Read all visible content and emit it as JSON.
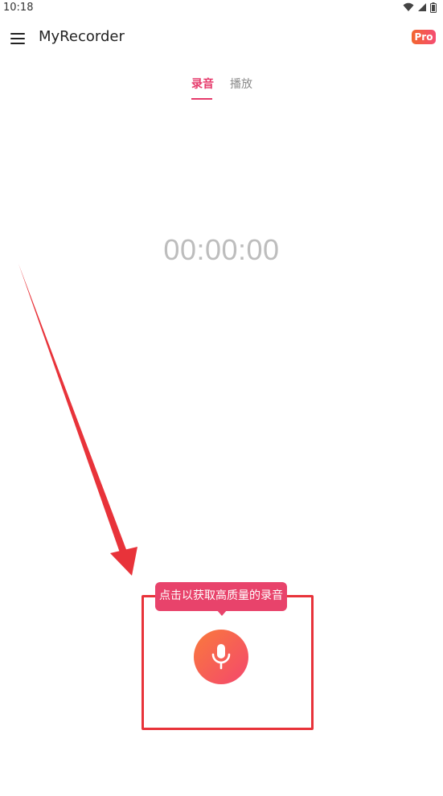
{
  "status_bar": {
    "time": "10:18",
    "icons": [
      "wifi-icon",
      "signal-icon",
      "battery-icon"
    ]
  },
  "app_bar": {
    "title": "MyRecorder",
    "pro_badge": "Pro",
    "menu_icon": "menu-icon"
  },
  "tabs": [
    {
      "label": "录音",
      "active": true
    },
    {
      "label": "播放",
      "active": false
    }
  ],
  "timer": "00:00:00",
  "tooltip": "点击以获取高质量的录音",
  "record_button": {
    "icon": "microphone-icon"
  },
  "colors": {
    "accent": "#e63a6b",
    "tooltip": "#e8436b",
    "button_gradient_start": "#f97a3c",
    "button_gradient_end": "#f4476d",
    "annotation": "#e8333a"
  }
}
